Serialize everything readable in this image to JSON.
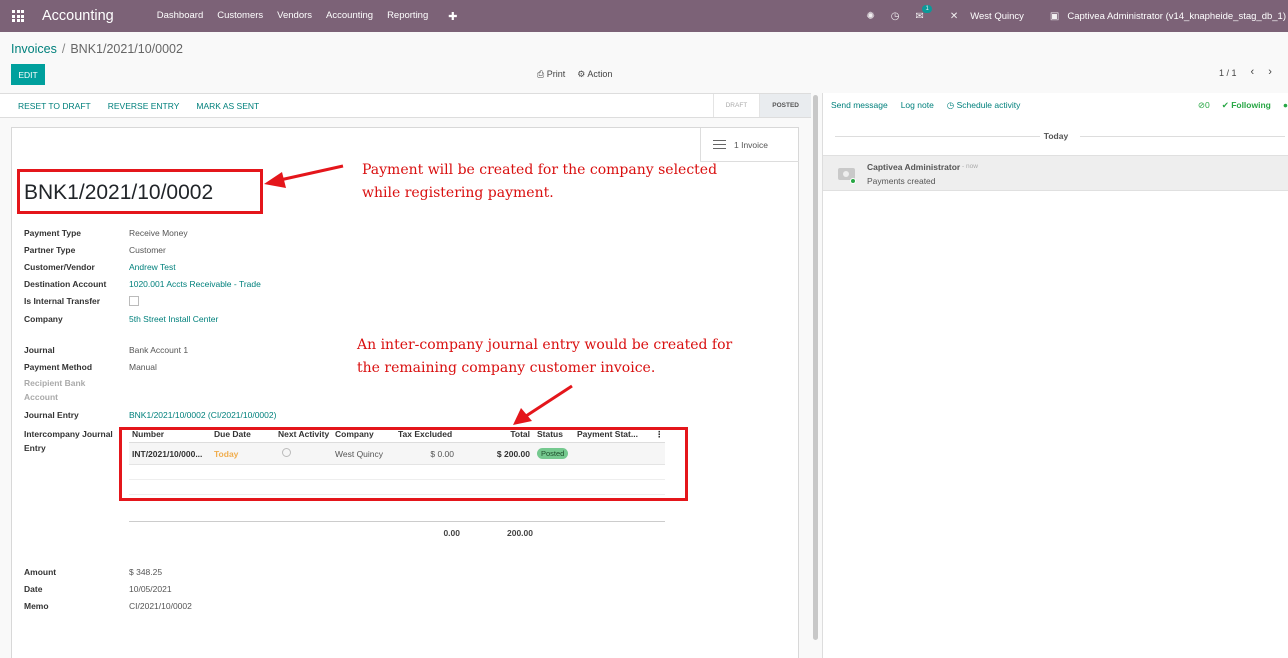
{
  "navbar": {
    "app_title": "Accounting",
    "menu": [
      "Dashboard",
      "Customers",
      "Vendors",
      "Accounting",
      "Reporting"
    ],
    "plus": "✚",
    "messages_badge": "1",
    "company": "West Quincy",
    "user": "Captivea Administrator (v14_knapheide_stag_db_1)"
  },
  "breadcrumb": {
    "parent": "Invoices",
    "sep": "/",
    "current": "BNK1/2021/10/0002"
  },
  "control": {
    "edit": "EDIT",
    "print": "Print",
    "action": "Action",
    "pager": "1 / 1"
  },
  "statusbar": {
    "actions": [
      "RESET TO DRAFT",
      "REVERSE ENTRY",
      "MARK AS SENT"
    ],
    "steps": [
      "DRAFT",
      "POSTED"
    ]
  },
  "form": {
    "smart_button": "1  Invoice",
    "title": "BNK1/2021/10/0002",
    "payment_type_label": "Payment Type",
    "payment_type": "Receive Money",
    "partner_type_label": "Partner Type",
    "partner_type": "Customer",
    "partner_label": "Customer/Vendor",
    "partner": "Andrew Test",
    "destination_label": "Destination Account",
    "destination": "1020.001 Accts Receivable - Trade",
    "internal_label": "Is Internal Transfer",
    "company_label": "Company",
    "company": "5th Street Install Center",
    "journal_label": "Journal",
    "journal": "Bank Account 1",
    "method_label": "Payment Method",
    "method": "Manual",
    "recipient_label_1": "Recipient Bank",
    "recipient_label_2": "Account",
    "entry_label": "Journal Entry",
    "entry": "BNK1/2021/10/0002 (CI/2021/10/0002)",
    "interco_label_1": "Intercompany Journal",
    "interco_label_2": "Entry",
    "amount_label": "Amount",
    "amount": "$ 348.25",
    "date_label": "Date",
    "date": "10/05/2021",
    "memo_label": "Memo",
    "memo": "CI/2021/10/0002"
  },
  "intercompany_table": {
    "headers": [
      "Number",
      "Due Date",
      "Next Activity",
      "Company",
      "Tax Excluded",
      "Total",
      "Status",
      "Payment Stat..."
    ],
    "row": {
      "number": "INT/2021/10/000...",
      "due": "Today",
      "company": "West Quincy",
      "tax_excluded": "$ 0.00",
      "total": "$ 200.00",
      "status": "Posted"
    },
    "footer": {
      "tax_excluded": "0.00",
      "total": "200.00"
    }
  },
  "annotations": {
    "note1_line1": "Payment will be created for the company selected",
    "note1_line2": "while registering payment.",
    "note2_line1": "An inter-company journal entry would be created for",
    "note2_line2": "the remaining company customer invoice."
  },
  "chatter": {
    "send_message": "Send message",
    "log_note": "Log note",
    "schedule_activity": "Schedule activity",
    "followers_count": "0",
    "following": "Following",
    "today": "Today",
    "author": "Captivea Administrator",
    "date": "- now",
    "body": "Payments created"
  },
  "colors": {
    "navbar": "#7c6277",
    "primary": "#00a09d",
    "link": "#00807c",
    "annotation": "#e4161b"
  }
}
